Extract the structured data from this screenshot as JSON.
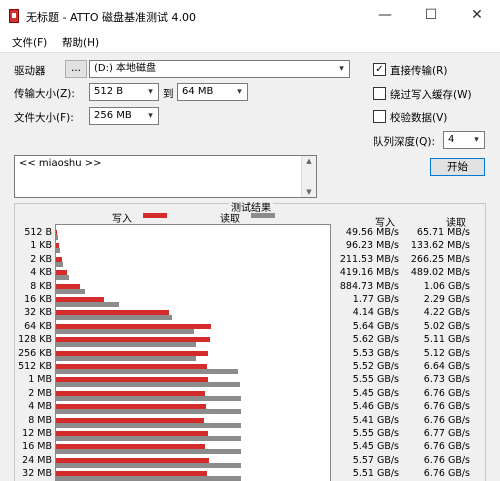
{
  "window": {
    "title": "无标题 - ATTO 磁盘基准测试 4.00",
    "minimize": "—",
    "maximize": "☐",
    "close": "✕"
  },
  "menu": [
    "文件(F)",
    "帮助(H)"
  ],
  "settings": {
    "drive_label": "驱动器",
    "drive_browse": "...",
    "drive_value": "(D:) 本地磁盘",
    "transfer_label": "传输大小(Z):",
    "transfer_from": "512 B",
    "transfer_to_label": "到",
    "transfer_to": "64 MB",
    "filesize_label": "文件大小(F):",
    "filesize_value": "256 MB"
  },
  "options": {
    "direct_io": {
      "label": "直接传输(R)",
      "checked": true
    },
    "bypass_cache": {
      "label": "绕过写入缓存(W)",
      "checked": false
    },
    "verify": {
      "label": "校验数据(V)",
      "checked": false
    },
    "queue_label": "队列深度(Q):",
    "queue_value": "4",
    "start_button": "开始"
  },
  "notes_text": "<< miaoshu >>",
  "results": {
    "title": "测试结果",
    "legend_write": "写入",
    "legend_read": "读取",
    "col_write": "写入",
    "col_read": "读取"
  },
  "chart_data": {
    "type": "bar",
    "title": "测试结果",
    "categories": [
      "512 B",
      "1 KB",
      "2 KB",
      "4 KB",
      "8 KB",
      "16 KB",
      "32 KB",
      "64 KB",
      "128 KB",
      "256 KB",
      "512 KB",
      "1 MB",
      "2 MB",
      "4 MB",
      "8 MB",
      "12 MB",
      "16 MB",
      "24 MB",
      "32 MB"
    ],
    "xlim": [
      0,
      10
    ],
    "series": [
      {
        "name": "写入",
        "color": "#d42b2b",
        "values": [
          0.0496,
          0.0962,
          0.2115,
          0.4192,
          0.8847,
          1.77,
          4.14,
          5.64,
          5.62,
          5.53,
          5.52,
          5.55,
          5.45,
          5.46,
          5.41,
          5.55,
          5.45,
          5.57,
          5.51
        ]
      },
      {
        "name": "读取",
        "color": "#8c8c8c",
        "values": [
          0.0657,
          0.1336,
          0.2663,
          0.489,
          1.06,
          2.29,
          4.22,
          5.02,
          5.11,
          5.12,
          6.64,
          6.73,
          6.76,
          6.76,
          6.76,
          6.77,
          6.76,
          6.76,
          6.76
        ]
      }
    ],
    "write_text": [
      "49.56 MB/s",
      "96.23 MB/s",
      "211.53 MB/s",
      "419.16 MB/s",
      "884.73 MB/s",
      "1.77 GB/s",
      "4.14 GB/s",
      "5.64 GB/s",
      "5.62 GB/s",
      "5.53 GB/s",
      "5.52 GB/s",
      "5.55 GB/s",
      "5.45 GB/s",
      "5.46 GB/s",
      "5.41 GB/s",
      "5.55 GB/s",
      "5.45 GB/s",
      "5.57 GB/s",
      "5.51 GB/s"
    ],
    "read_text": [
      "65.71 MB/s",
      "133.62 MB/s",
      "266.25 MB/s",
      "489.02 MB/s",
      "1.06 GB/s",
      "2.29 GB/s",
      "4.22 GB/s",
      "5.02 GB/s",
      "5.11 GB/s",
      "5.12 GB/s",
      "6.64 GB/s",
      "6.73 GB/s",
      "6.76 GB/s",
      "6.76 GB/s",
      "6.76 GB/s",
      "6.77 GB/s",
      "6.76 GB/s",
      "6.76 GB/s",
      "6.76 GB/s"
    ]
  }
}
